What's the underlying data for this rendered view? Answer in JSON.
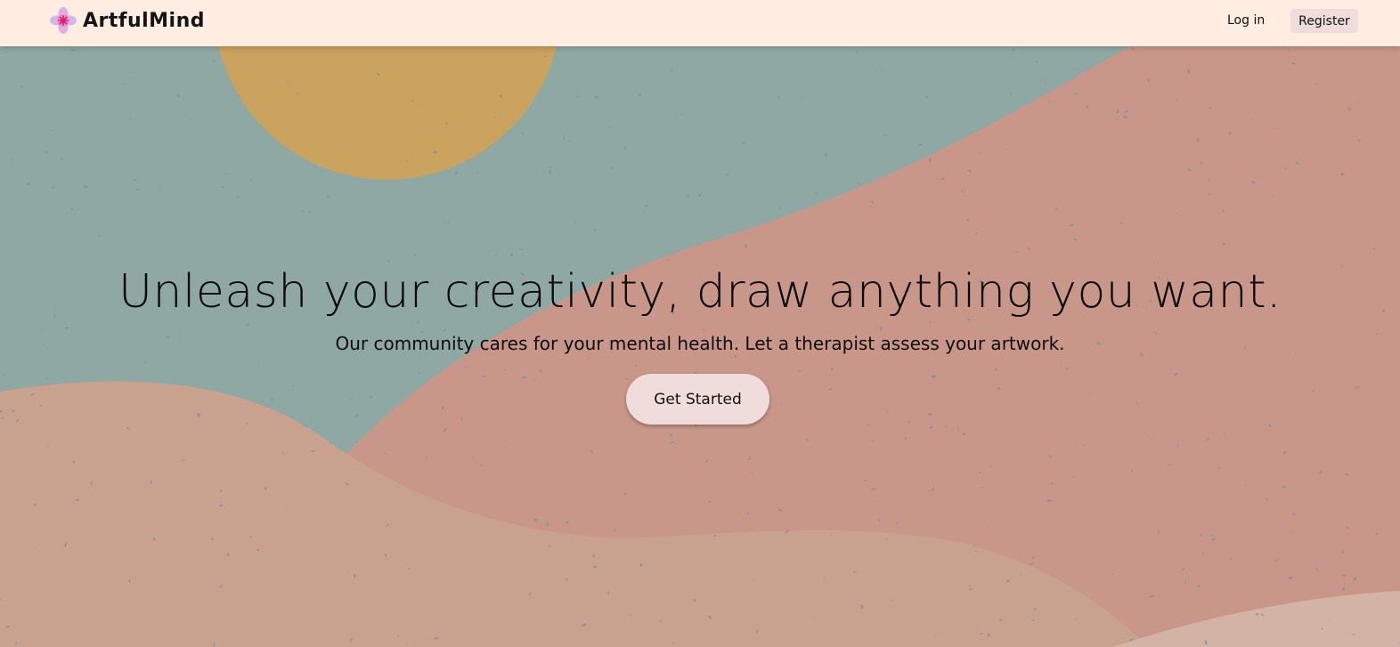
{
  "nav": {
    "brand": "ArtfulMind",
    "login_label": "Log in",
    "register_label": "Register"
  },
  "hero": {
    "title": "Unleash your creativity, draw anything you want.",
    "subtitle": "Our community cares for your mental health. Let a therapist assess your artwork.",
    "cta_label": "Get Started"
  },
  "icons": {
    "brand_logo": "flower-icon"
  },
  "colors": {
    "navbar_bg": "#ffede1",
    "button_bg": "#f1dcdc",
    "sky": "#8fa8a4",
    "sun": "#caa35f",
    "terracotta": "#c9978a",
    "sand": "#c9a18f",
    "pale_sand": "#d2b3a6"
  }
}
